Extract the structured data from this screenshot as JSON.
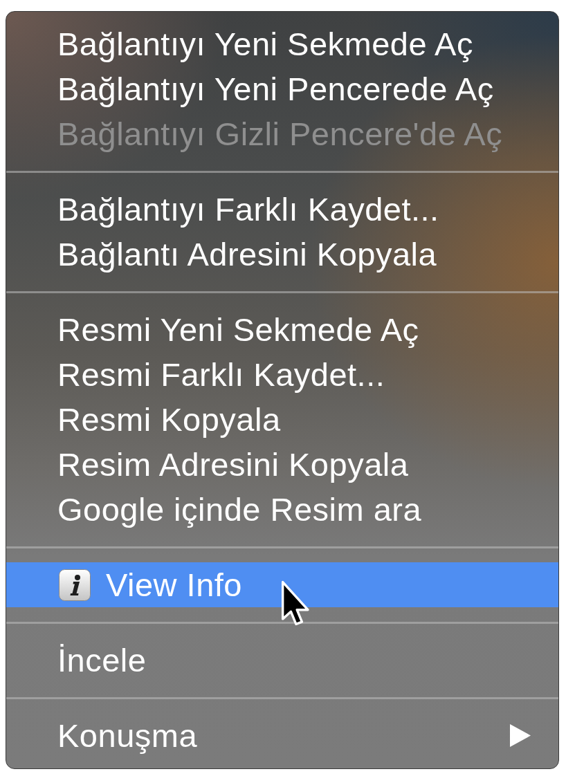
{
  "context_menu": {
    "groups": [
      {
        "items": [
          {
            "label": "Bağlantıyı Yeni Sekmede Aç",
            "kind": "plain",
            "disabled": false,
            "selected": false
          },
          {
            "label": "Bağlantıyı Yeni Pencerede Aç",
            "kind": "plain",
            "disabled": false,
            "selected": false
          },
          {
            "label": "Bağlantıyı Gizli Pencere'de Aç",
            "kind": "plain",
            "disabled": true,
            "selected": false
          }
        ]
      },
      {
        "items": [
          {
            "label": "Bağlantıyı Farklı Kaydet...",
            "kind": "plain",
            "disabled": false,
            "selected": false
          },
          {
            "label": "Bağlantı Adresini Kopyala",
            "kind": "plain",
            "disabled": false,
            "selected": false
          }
        ]
      },
      {
        "items": [
          {
            "label": "Resmi Yeni Sekmede Aç",
            "kind": "plain",
            "disabled": false,
            "selected": false
          },
          {
            "label": "Resmi Farklı Kaydet...",
            "kind": "plain",
            "disabled": false,
            "selected": false
          },
          {
            "label": "Resmi Kopyala",
            "kind": "plain",
            "disabled": false,
            "selected": false
          },
          {
            "label": "Resim Adresini Kopyala",
            "kind": "plain",
            "disabled": false,
            "selected": false
          },
          {
            "label": "Google içinde Resim ara",
            "kind": "plain",
            "disabled": false,
            "selected": false
          }
        ]
      },
      {
        "items": [
          {
            "label": "View Info",
            "kind": "info",
            "disabled": false,
            "selected": true
          }
        ]
      },
      {
        "items": [
          {
            "label": "İncele",
            "kind": "plain",
            "disabled": false,
            "selected": false
          }
        ]
      },
      {
        "items": [
          {
            "label": "Konuşma",
            "kind": "submenu",
            "disabled": false,
            "selected": false
          }
        ]
      }
    ]
  }
}
